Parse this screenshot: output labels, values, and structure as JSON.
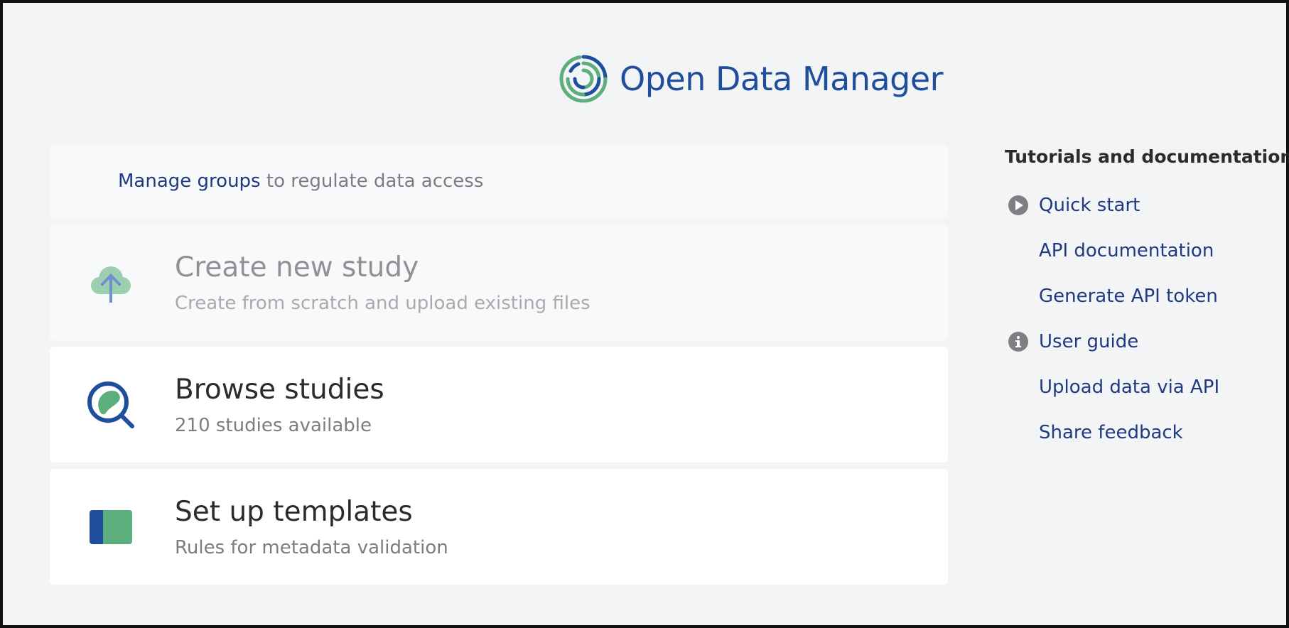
{
  "app": {
    "brand_name": "Open Data Manager"
  },
  "manage": {
    "link_text": "Manage groups",
    "rest_text": " to regulate data access"
  },
  "cards": [
    {
      "title": "Create new study",
      "subtitle": "Create from scratch and upload existing files",
      "icon": "cloud-upload-icon"
    },
    {
      "title": "Browse studies",
      "subtitle": "210 studies available",
      "icon": "search-study-icon"
    },
    {
      "title": "Set up templates",
      "subtitle": "Rules for metadata validation",
      "icon": "template-icon"
    }
  ],
  "sidebar": {
    "title": "Tutorials and documentation",
    "items": [
      {
        "label": "Quick start",
        "icon": "play-icon"
      },
      {
        "label": "API documentation",
        "icon": ""
      },
      {
        "label": "Generate API token",
        "icon": ""
      },
      {
        "label": "User guide",
        "icon": "info-icon"
      },
      {
        "label": "Upload data via API",
        "icon": ""
      },
      {
        "label": "Share feedback",
        "icon": ""
      }
    ]
  },
  "colors": {
    "brand_blue": "#1f4e9d",
    "brand_green": "#5dae7d",
    "link": "#1e3a82",
    "background": "#f3f4f6"
  }
}
